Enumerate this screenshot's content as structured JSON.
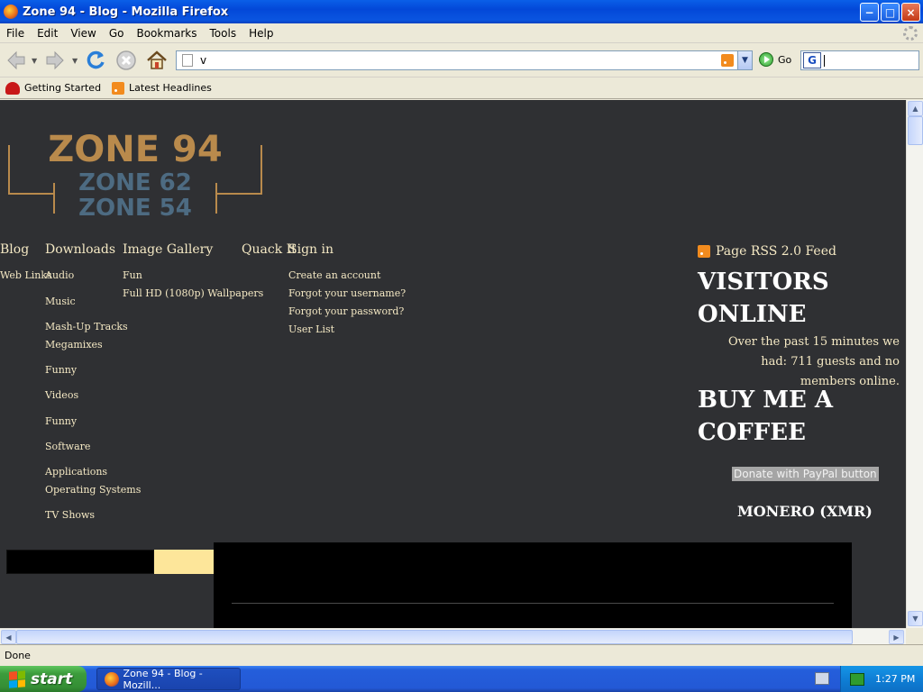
{
  "window": {
    "title": "Zone 94 - Blog - Mozilla Firefox",
    "buttons": {
      "minimize": "−",
      "maximize": "□",
      "close": "×"
    }
  },
  "menu": [
    "File",
    "Edit",
    "View",
    "Go",
    "Bookmarks",
    "Tools",
    "Help"
  ],
  "toolbar": {
    "url": "v",
    "go_label": "Go",
    "search_engine": "G",
    "search_value": ""
  },
  "bookmarks": [
    {
      "label": "Getting Started",
      "icon": "firefox-icon"
    },
    {
      "label": "Latest Headlines",
      "icon": "rss-icon"
    }
  ],
  "site": {
    "logo": {
      "line1": "ZONE 94",
      "line2": "ZONE 62",
      "line3": "ZONE 54"
    },
    "nav": [
      "Blog",
      "Downloads",
      "Image Gallery",
      "Quack It",
      "Sign in"
    ],
    "blog_sub": [
      "Web Links"
    ],
    "downloads_sub": [
      "Audio",
      "Music",
      "Mash-Up Tracks",
      "Megamixes",
      "Funny",
      "Videos",
      "Funny",
      "Software",
      "Applications",
      "Operating Systems",
      "TV Shows"
    ],
    "gallery_sub": [
      "Fun",
      "Full HD (1080p) Wallpapers"
    ],
    "signin_sub": [
      "Create an account",
      "Forgot your username?",
      "Forgot your password?",
      "User List"
    ],
    "rss_label": "Page RSS 2.0 Feed",
    "visitors_title": "VISITORS ONLINE",
    "visitors_text": "Over the past 15 minutes we had: 711 guests and no members online.",
    "coffee_title": "BUY ME A COFFEE",
    "donate_label": "Donate with PayPal button",
    "monero_title": "MONERO (XMR)"
  },
  "status": "Done",
  "taskbar": {
    "start_label": "start",
    "task_label": "Zone 94 - Blog - Mozill...",
    "clock": "1:27 PM"
  },
  "colors": {
    "page_bg": "#2f3033",
    "link_text": "#f5e9c4",
    "logo_orange": "#b98a4c",
    "logo_blue": "#4d6b82",
    "search_button": "#fde69a"
  }
}
